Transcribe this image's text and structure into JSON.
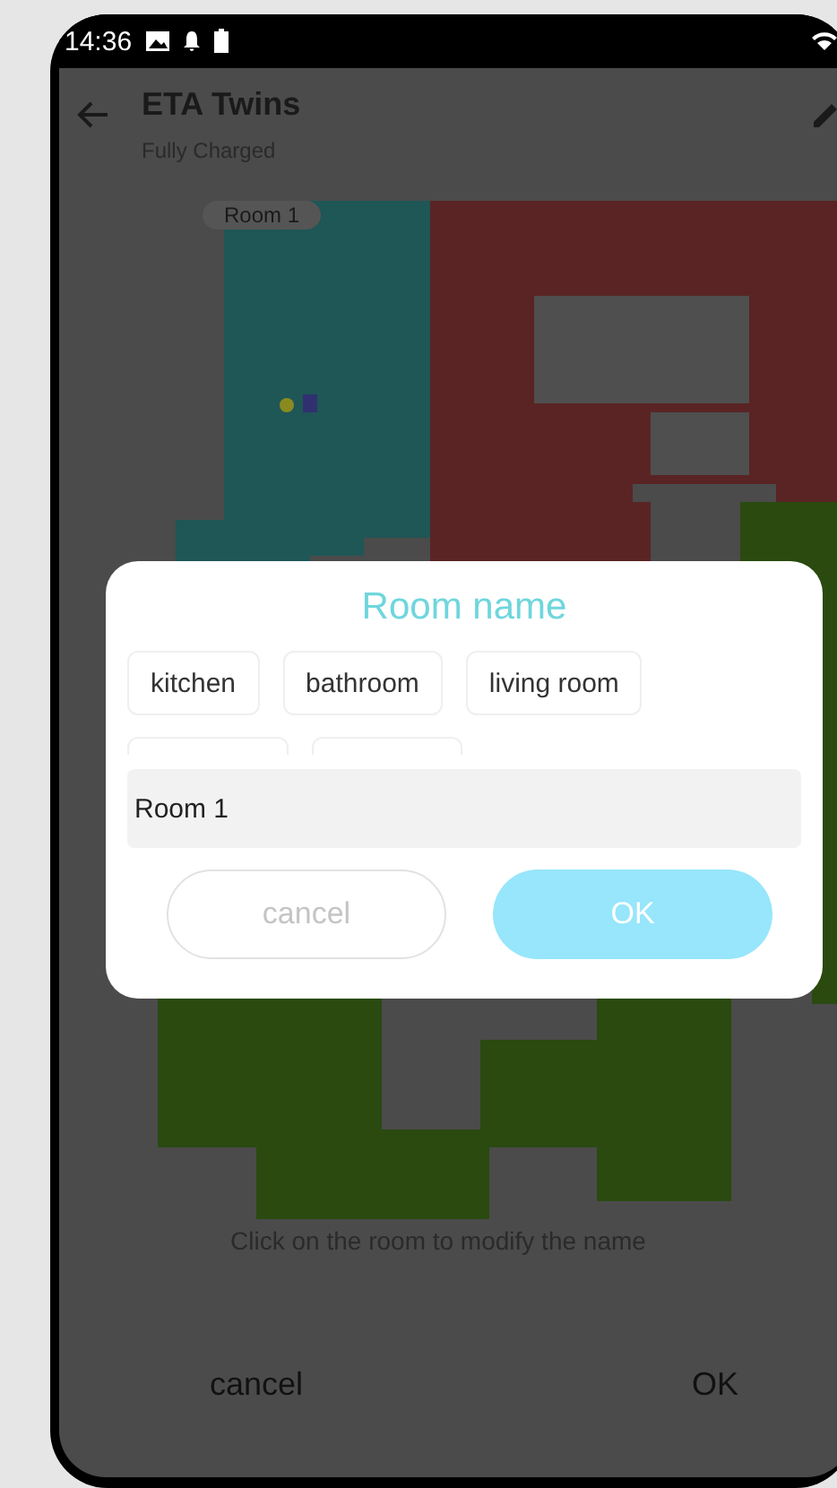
{
  "status_bar": {
    "time": "14:36"
  },
  "app_bar": {
    "title": "ETA Twins",
    "subtitle": "Fully Charged"
  },
  "map": {
    "room_label": "Room 1"
  },
  "hint": "Click on the room to modify the name",
  "bottom_bar": {
    "buttons": [
      "cancel",
      "OK"
    ]
  },
  "dialog": {
    "title": "Room name",
    "suggestions": [
      "kitchen",
      "bathroom",
      "living room"
    ],
    "name_field": {
      "value": "Room 1"
    },
    "buttons": [
      {
        "label": "cancel",
        "kind": "secondary"
      },
      {
        "label": "OK",
        "kind": "primary"
      }
    ]
  }
}
